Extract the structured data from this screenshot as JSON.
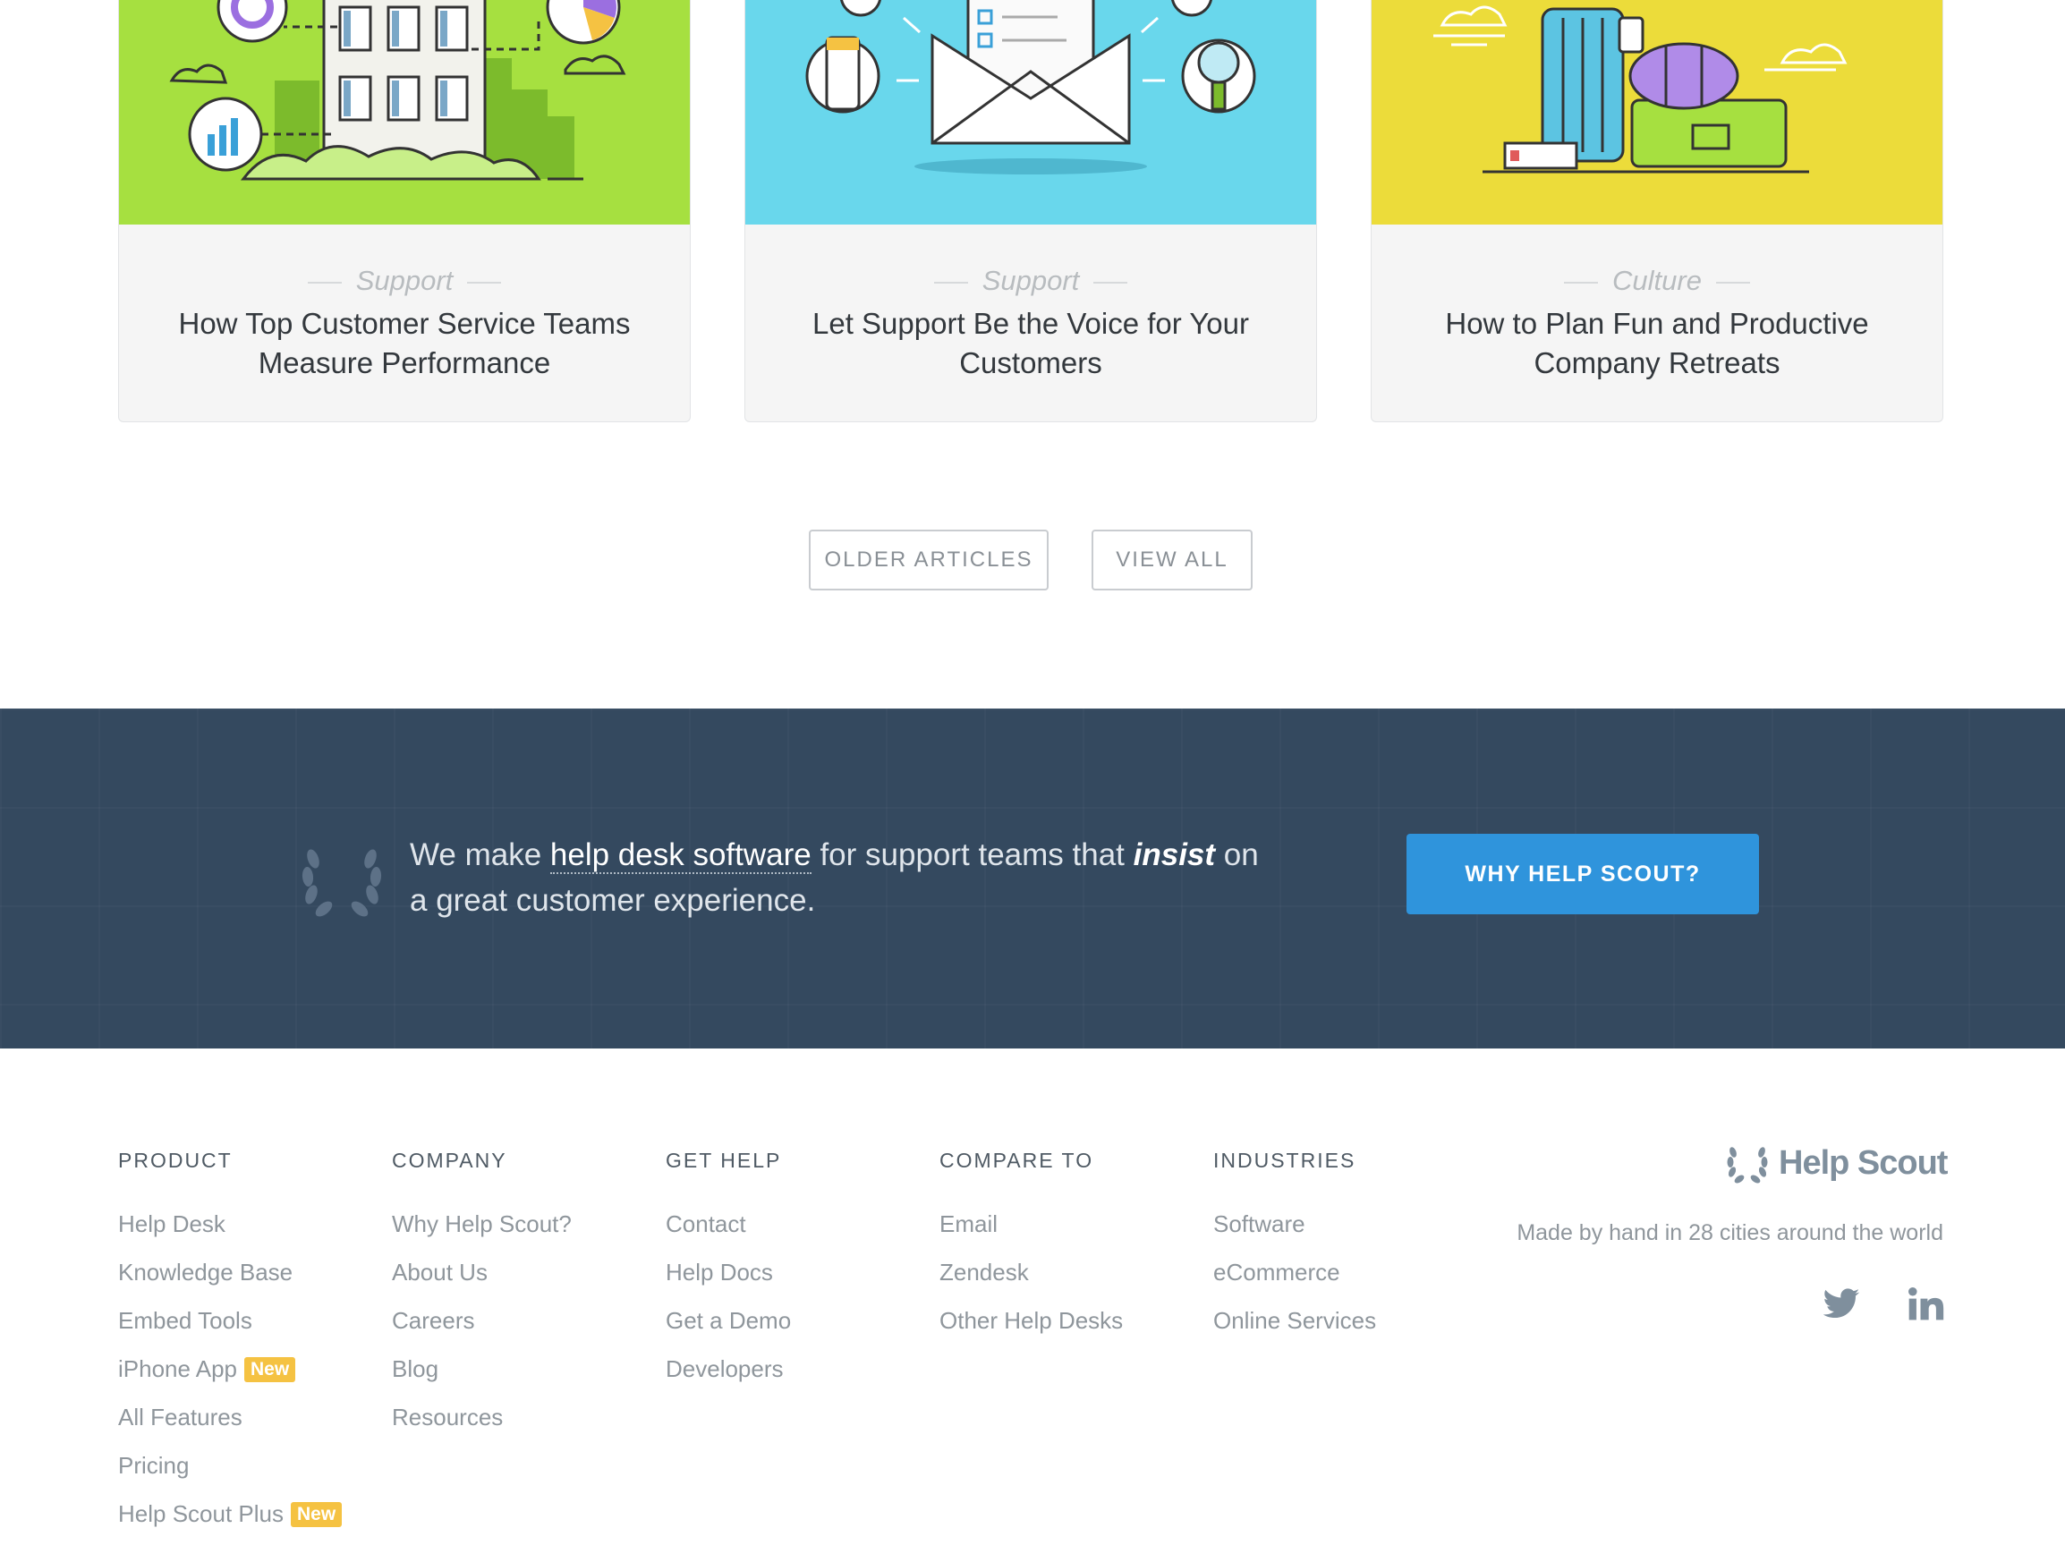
{
  "cards": [
    {
      "category": "Support",
      "title_line1": "How Top Customer Service Teams",
      "title_line2": "Measure Performance",
      "art_color": "#a6e040"
    },
    {
      "category": "Support",
      "title_line1": "Let Support Be the Voice for Your",
      "title_line2": "Customers",
      "art_color": "#69d7ec"
    },
    {
      "category": "Culture",
      "title_line1": "How to Plan Fun and Productive",
      "title_line2": "Company Retreats",
      "art_color": "#ecdc3a"
    }
  ],
  "pagination": {
    "older_label": "OLDER ARTICLES",
    "view_all_label": "VIEW ALL"
  },
  "promo": {
    "text_before": "We make ",
    "link_text": "help desk software",
    "text_middle": " for support teams that ",
    "emphasis": "insist",
    "text_after": " on a great customer experience.",
    "cta_label": "WHY HELP SCOUT?",
    "background_color": "#34495f",
    "cta_color": "#2f94dc"
  },
  "footer": {
    "columns": [
      {
        "heading": "PRODUCT",
        "links": [
          {
            "label": "Help Desk"
          },
          {
            "label": "Knowledge Base"
          },
          {
            "label": "Embed Tools"
          },
          {
            "label": "iPhone App",
            "badge": "New"
          },
          {
            "label": "All Features"
          },
          {
            "label": "Pricing"
          },
          {
            "label": "Help Scout Plus",
            "badge": "New"
          }
        ]
      },
      {
        "heading": "COMPANY",
        "links": [
          {
            "label": "Why Help Scout?"
          },
          {
            "label": "About Us"
          },
          {
            "label": "Careers"
          },
          {
            "label": "Blog"
          },
          {
            "label": "Resources"
          }
        ]
      },
      {
        "heading": "GET HELP",
        "links": [
          {
            "label": "Contact"
          },
          {
            "label": "Help Docs"
          },
          {
            "label": "Get a Demo"
          },
          {
            "label": "Developers"
          }
        ]
      },
      {
        "heading": "COMPARE TO",
        "links": [
          {
            "label": "Email"
          },
          {
            "label": "Zendesk"
          },
          {
            "label": "Other Help Desks"
          }
        ]
      },
      {
        "heading": "INDUSTRIES",
        "links": [
          {
            "label": "Software"
          },
          {
            "label": "eCommerce"
          },
          {
            "label": "Online Services"
          }
        ]
      }
    ],
    "brand": "Help Scout",
    "tagline": "Made by hand in 28 cities around the world",
    "social": [
      "twitter-icon",
      "linkedin-icon"
    ],
    "badge_color": "#f5c242"
  }
}
